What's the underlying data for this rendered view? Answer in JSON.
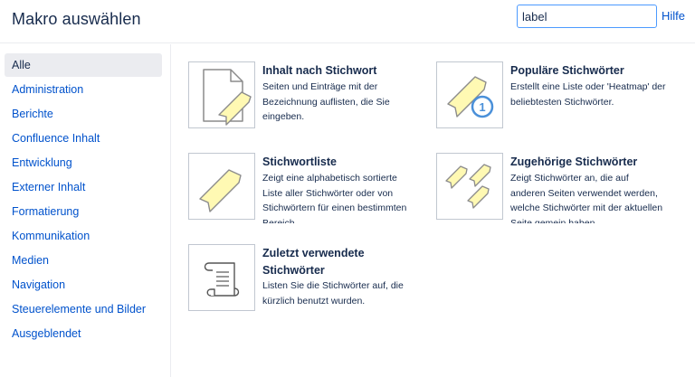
{
  "header": {
    "title": "Makro auswählen",
    "search_value": "label",
    "help_label": "Hilfe"
  },
  "categories": [
    "Alle",
    "Administration",
    "Berichte",
    "Confluence Inhalt",
    "Entwicklung",
    "Externer Inhalt",
    "Formatierung",
    "Kommunikation",
    "Medien",
    "Navigation",
    "Steuerelemente und Bilder",
    "Ausgeblendet"
  ],
  "active_category": "Alle",
  "macros": [
    {
      "name": "Inhalt nach Stichwort",
      "description": "Seiten und Einträge mit der Bezeichnung auflisten, die Sie eingeben.",
      "icon": "page-with-label-icon"
    },
    {
      "name": "Populäre Stichwörter",
      "description": "Erstellt eine Liste oder 'Heatmap' der beliebtesten Stichwörter.",
      "icon": "popular-label-icon"
    },
    {
      "name": "Stichwortliste",
      "description": "Zeigt eine alphabetisch sortierte Liste aller Stichwörter oder von Stichwörtern für einen bestimmten Bereich.",
      "icon": "label-icon"
    },
    {
      "name": "Zugehörige Stichwörter",
      "description": "Zeigt Stichwörter an, die auf anderen Seiten verwendet werden, welche Stichwörter mit der aktuellen Seite gemein haben.",
      "icon": "related-labels-icon"
    },
    {
      "name": "Zuletzt verwendete Stichwörter",
      "description": "Listen Sie die Stichwörter auf, die kürzlich benutzt wurden.",
      "icon": "scroll-icon"
    }
  ],
  "colors": {
    "link": "#0052cc",
    "text": "#172b4d",
    "label_fill": "#fff9b3",
    "icon_stroke": "#8c8c8c",
    "badge": "#4a90d9"
  }
}
